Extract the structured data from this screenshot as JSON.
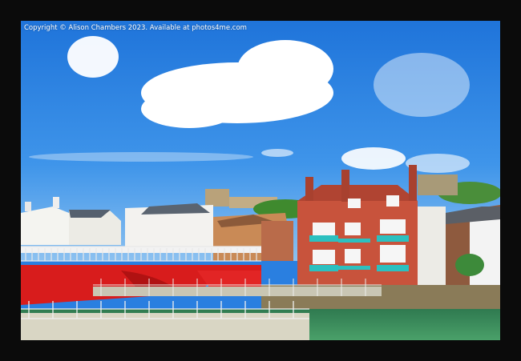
{
  "copyright": "Copyright © Alison Chambers 2023. Available at photos4me.com",
  "scene": {
    "sky_color": "#2e86e6",
    "water_color": "#3c8c5c",
    "bridge_color": "#d81c1c",
    "building_color": "#c8533c",
    "accent_color": "#2cc0c0"
  }
}
